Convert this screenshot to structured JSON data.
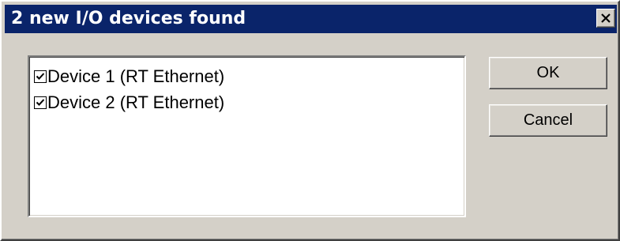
{
  "window": {
    "title": "2 new I/O devices found",
    "close_icon": "close-icon",
    "colors": {
      "titlebar": "#0a246a",
      "face": "#d4d0c8",
      "list_background": "#ffffff"
    }
  },
  "device_list": {
    "items": [
      {
        "label": "Device 1 (RT Ethernet)",
        "checked": true
      },
      {
        "label": "Device 2 (RT Ethernet)",
        "checked": true
      }
    ]
  },
  "buttons": {
    "ok_label": "OK",
    "cancel_label": "Cancel"
  }
}
